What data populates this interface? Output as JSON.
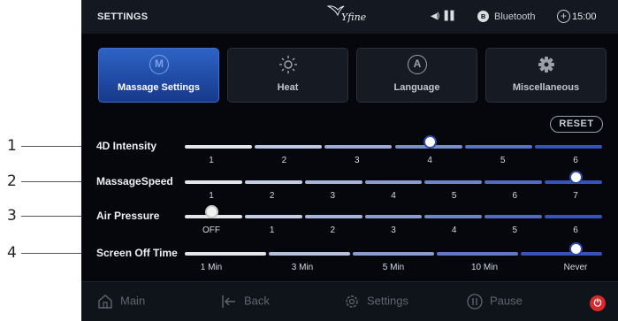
{
  "callouts": [
    "1",
    "2",
    "3",
    "4"
  ],
  "status_bar": {
    "title": "SETTINGS",
    "logo_text": "Yfine",
    "signal_glyphs": "◀) ▐▐",
    "bluetooth_label": "Bluetooth",
    "time": "15:00"
  },
  "tabs": [
    {
      "label": "Massage Settings",
      "icon": "M",
      "active": true
    },
    {
      "label": "Heat",
      "icon": "sun-icon",
      "active": false
    },
    {
      "label": "Language",
      "icon": "A",
      "active": false
    },
    {
      "label": "Miscellaneous",
      "icon": "gear-icon",
      "active": false
    }
  ],
  "reset_label": "RESET",
  "settings": [
    {
      "label": "4D Intensity",
      "options": [
        "1",
        "2",
        "3",
        "4",
        "5",
        "6"
      ],
      "selected": "4"
    },
    {
      "label": "MassageSpeed",
      "options": [
        "1",
        "2",
        "3",
        "4",
        "5",
        "6",
        "7"
      ],
      "selected": "7"
    },
    {
      "label": "Air Pressure",
      "options": [
        "OFF",
        "1",
        "2",
        "3",
        "4",
        "5",
        "6"
      ],
      "selected": "OFF"
    },
    {
      "label": "Screen Off Time",
      "options": [
        "1 Min",
        "3 Min",
        "5 Min",
        "10 Min",
        "Never"
      ],
      "selected": "Never"
    }
  ],
  "nav": {
    "main": "Main",
    "back": "Back",
    "settings": "Settings",
    "pause": "Pause"
  },
  "colors": {
    "accent": "#2d63c5",
    "track_start": "#e2e5ea",
    "track_end": "#3553b8",
    "power": "#d7292b"
  }
}
